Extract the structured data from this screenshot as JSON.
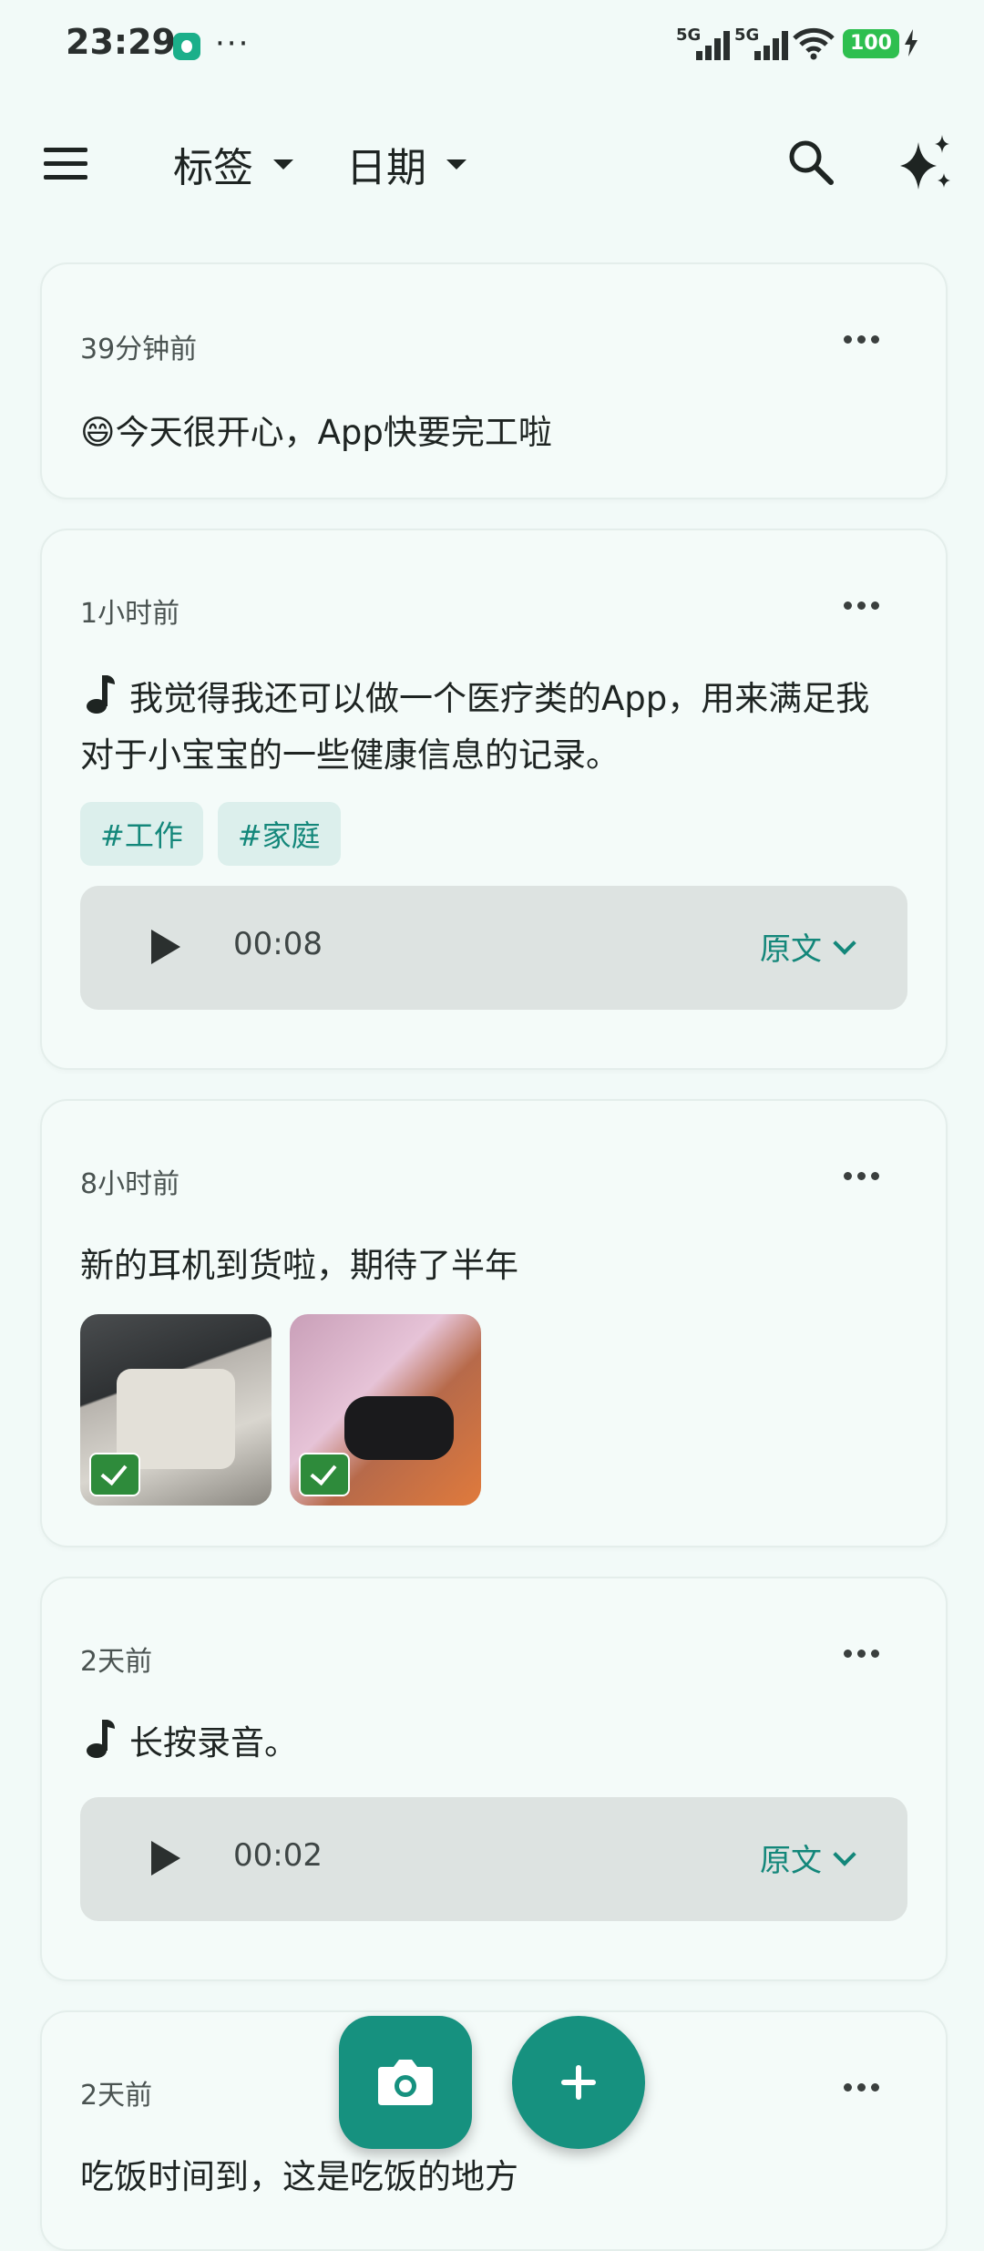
{
  "status_bar": {
    "time": "23:29",
    "more": "···",
    "signal1_label": "5G",
    "signal2_label": "5G",
    "battery": "100"
  },
  "top_bar": {
    "filter_tags": "标签",
    "filter_date": "日期"
  },
  "notes": [
    {
      "time_ago": "39分钟前",
      "text": "😄今天很开心，App快要完工啦"
    },
    {
      "time_ago": "1小时前",
      "text": "我觉得我还可以做一个医疗类的App，用来满足我对于小宝宝的一些健康信息的记录。",
      "tags": [
        "#工作",
        "#家庭"
      ],
      "audio": {
        "duration": "00:08",
        "transcript_label": "原文"
      }
    },
    {
      "time_ago": "8小时前",
      "text": "新的耳机到货啦，期待了半年"
    },
    {
      "time_ago": "2天前",
      "text": "长按录音。",
      "audio": {
        "duration": "00:02",
        "transcript_label": "原文"
      }
    },
    {
      "time_ago": "2天前",
      "text": "吃饭时间到，这是吃饭的地方"
    }
  ],
  "colors": {
    "accent": "#16917F",
    "tag_bg": "#DCEFEC",
    "background": "#F2FAF8"
  }
}
